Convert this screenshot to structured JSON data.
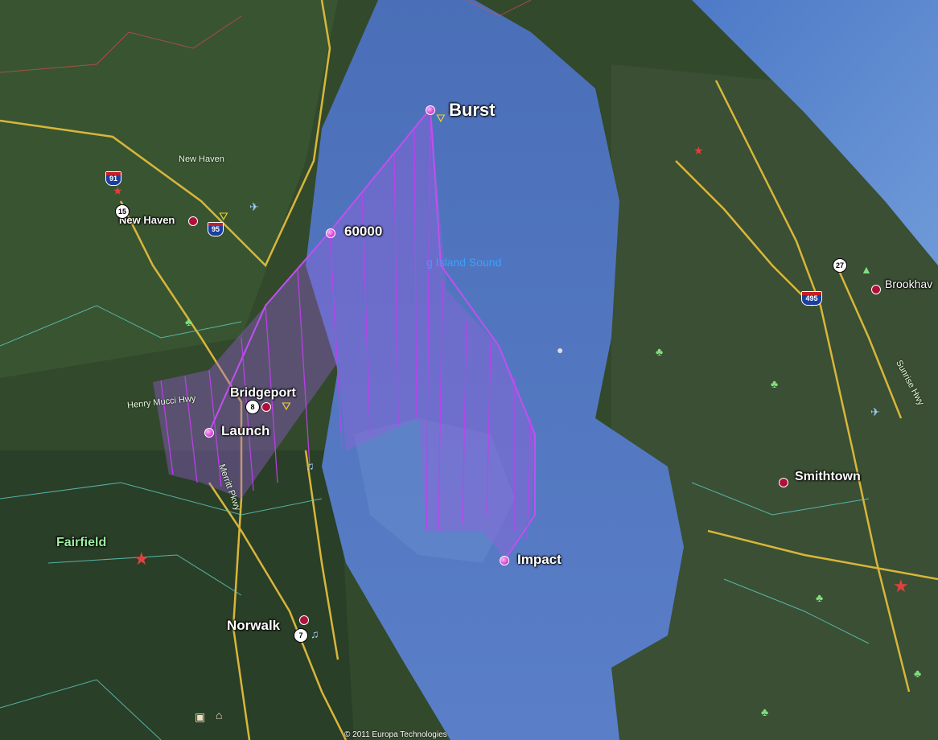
{
  "map": {
    "labels": {
      "burst": "Burst",
      "altitude": "60000",
      "launch": "Launch",
      "impact": "Impact",
      "water_body": "g Island Sound",
      "new_haven_area": "New Haven",
      "new_haven_city": "New Haven",
      "bridgeport": "Bridgeport",
      "fairfield": "Fairfield",
      "norwalk": "Norwalk",
      "smithtown": "Smithtown",
      "brookhaven": "Brookhav",
      "highway_henry": "Henry Mucci Hwy",
      "highway_merritt": "Merritt Pkwy",
      "highway_east": "Sunrise Hwy"
    },
    "shields": {
      "i91": "91",
      "i95": "95",
      "i495": "495",
      "r15": "15",
      "r8": "8",
      "r7": "7",
      "r27": "27"
    },
    "copyright": "© 2011 Europa Technologies",
    "icons": {
      "airport": "airport-icon",
      "star": "star-icon",
      "park": "park-icon",
      "music": "music-icon",
      "balloon": "balloon-icon",
      "museum": "museum-icon",
      "camera": "camera-icon"
    },
    "colors": {
      "flight_path": "#b040e0",
      "flight_fill": "#9b5fe0",
      "water": "#3a5da8",
      "land": "#2f4a2a",
      "road": "#d9b63a"
    }
  }
}
